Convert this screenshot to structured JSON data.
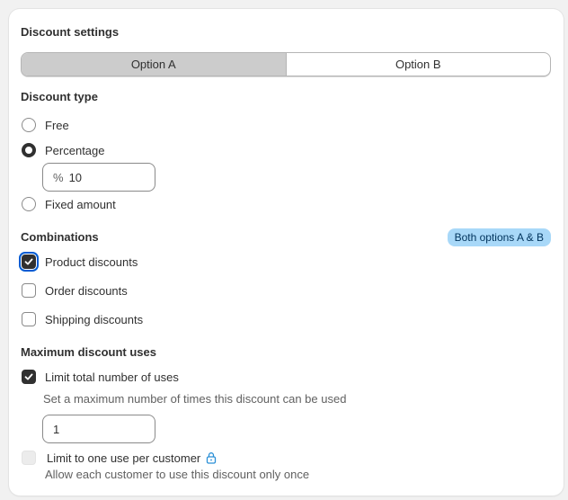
{
  "card": {
    "title": "Discount settings",
    "tabs": [
      {
        "label": "Option A",
        "active": true
      },
      {
        "label": "Option B",
        "active": false
      }
    ]
  },
  "discount_type": {
    "heading": "Discount type",
    "options": [
      {
        "label": "Free",
        "checked": false
      },
      {
        "label": "Percentage",
        "checked": true
      },
      {
        "label": "Fixed amount",
        "checked": false
      }
    ],
    "percentage_input": {
      "prefix": "%",
      "value": "10"
    }
  },
  "combinations": {
    "heading": "Combinations",
    "badge": "Both options A & B",
    "items": [
      {
        "label": "Product discounts",
        "checked": true
      },
      {
        "label": "Order discounts",
        "checked": false
      },
      {
        "label": "Shipping discounts",
        "checked": false
      }
    ]
  },
  "max_uses": {
    "heading": "Maximum discount uses",
    "limit_total": {
      "label": "Limit total number of uses",
      "checked": true,
      "help": "Set a maximum number of times this discount can be used",
      "value": "1"
    },
    "limit_customer": {
      "label": "Limit to one use per customer",
      "checked": false,
      "disabled": true,
      "help": "Allow each customer to use this discount only once",
      "icon": "lock-icon"
    }
  },
  "colors": {
    "primary": "#303030",
    "badge_bg": "#a8d8f8",
    "focus": "#005bd3",
    "lock": "#2a8fd6"
  }
}
